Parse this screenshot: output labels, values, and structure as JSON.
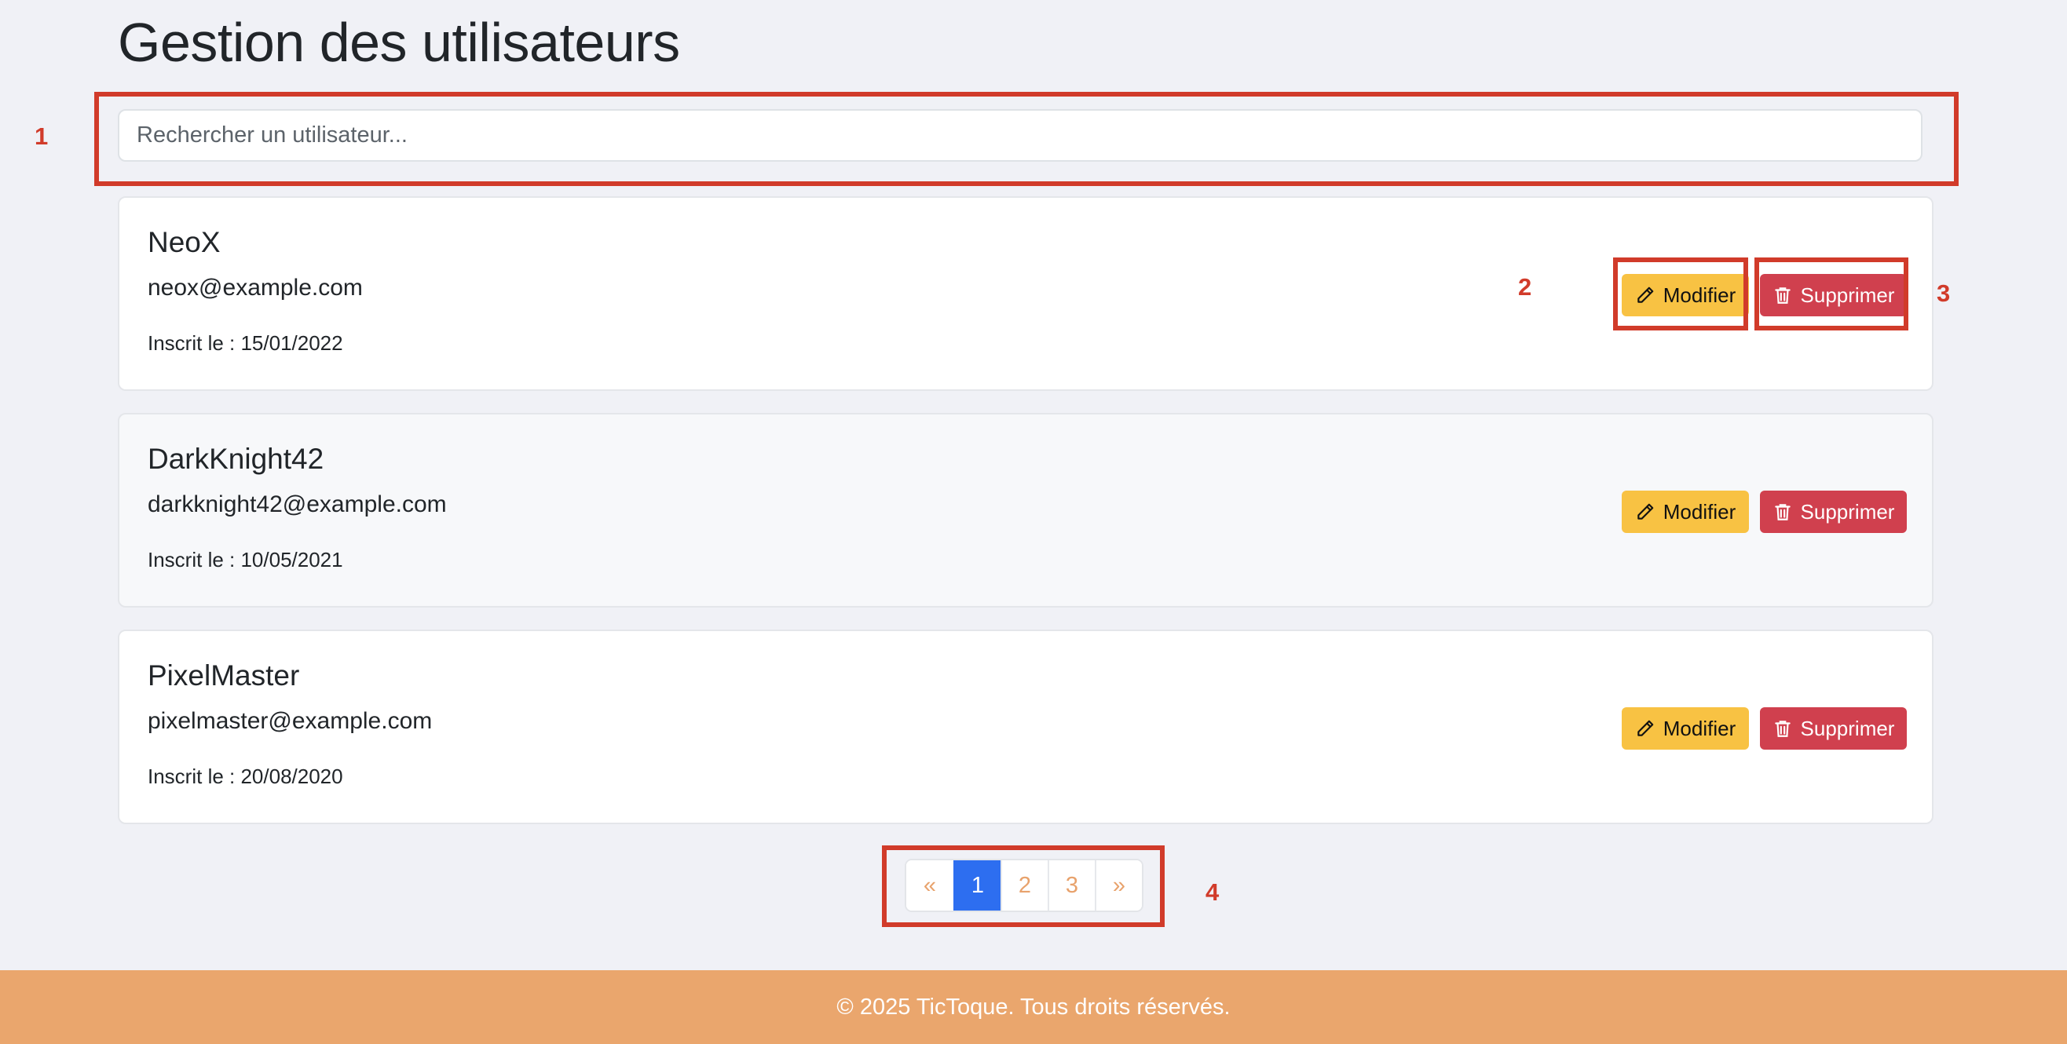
{
  "page": {
    "title": "Gestion des utilisateurs"
  },
  "search": {
    "placeholder": "Rechercher un utilisateur...",
    "value": ""
  },
  "users": [
    {
      "name": "NeoX",
      "email": "neox@example.com",
      "date_label": "Inscrit le : 15/01/2022"
    },
    {
      "name": "DarkKnight42",
      "email": "darkknight42@example.com",
      "date_label": "Inscrit le : 10/05/2021"
    },
    {
      "name": "PixelMaster",
      "email": "pixelmaster@example.com",
      "date_label": "Inscrit le : 20/08/2020"
    }
  ],
  "actions": {
    "edit_label": "Modifier",
    "delete_label": "Supprimer"
  },
  "pagination": {
    "prev": "«",
    "pages": [
      "1",
      "2",
      "3"
    ],
    "next": "»",
    "active_page": "1"
  },
  "annotations": [
    "1",
    "2",
    "3",
    "4"
  ],
  "footer": {
    "text": "© 2025 TicToque. Tous droits réservés."
  },
  "icons": {
    "edit": "pencil-icon",
    "delete": "trash-icon"
  },
  "colors": {
    "edit_button": "#f8c243",
    "delete_button": "#d0404e",
    "active_page": "#2d6ef0",
    "page_link": "#e8a26c",
    "footer": "#eaa66d",
    "annotation": "#d13b2a"
  }
}
